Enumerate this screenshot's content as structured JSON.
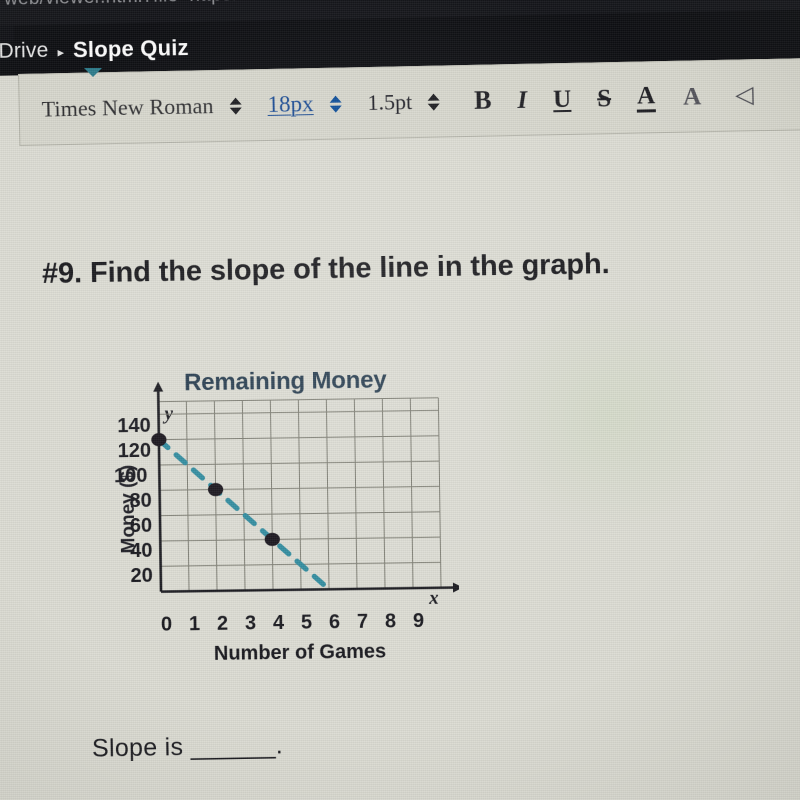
{
  "browser": {
    "url_fragment": "web/viewer.html?file=https..."
  },
  "breadcrumb": {
    "root_label": "Drive",
    "separator": "▸",
    "current_label": "Slope Quiz"
  },
  "toolbar": {
    "font_family_value": "Times New Roman",
    "font_size_value": "18px",
    "line_height_value": "1.5pt",
    "bold_label": "B",
    "italic_label": "I",
    "underline_label": "U",
    "strikethrough_label": "S",
    "text_color_label": "A",
    "highlight_label": "A",
    "edge_icon_label": "◁"
  },
  "worksheet": {
    "question": "#9. Find the slope of the line in the graph.",
    "answer_prompt": "Slope is ______."
  },
  "chart_data": {
    "type": "line",
    "title": "Remaining Money",
    "xlabel": "Number of Games",
    "ylabel": "Money ($)",
    "x_axis_glyph": "x",
    "y_axis_glyph": "y",
    "xlim": [
      0,
      10
    ],
    "ylim": [
      0,
      150
    ],
    "xticks": [
      "0",
      "1",
      "2",
      "3",
      "4",
      "5",
      "6",
      "7",
      "8",
      "9"
    ],
    "xtick_values": [
      0,
      1,
      2,
      3,
      4,
      5,
      6,
      7,
      8,
      9
    ],
    "yticks": [
      "20",
      "40",
      "60",
      "80",
      "100",
      "120",
      "140"
    ],
    "ytick_values": [
      20,
      40,
      60,
      80,
      100,
      120,
      140
    ],
    "grid": true,
    "legend": "none",
    "line_style": "dashed",
    "line_color": "#2d8a9e",
    "point_color": "#141018",
    "series": [
      {
        "name": "Remaining Money",
        "x": [
          0,
          2,
          4,
          6
        ],
        "values": [
          120,
          80,
          40,
          0
        ],
        "plotted_points": [
          {
            "x": 0,
            "y": 120
          },
          {
            "x": 2,
            "y": 80
          },
          {
            "x": 4,
            "y": 40
          }
        ],
        "x_intercept": 6,
        "y_intercept": 120,
        "slope": -20
      }
    ]
  }
}
